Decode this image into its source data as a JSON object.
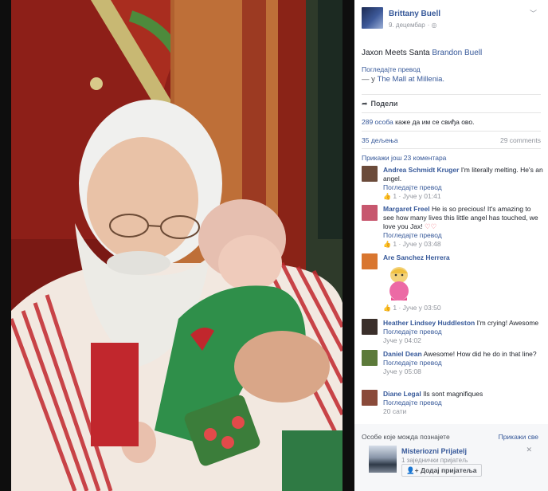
{
  "post": {
    "author": "Brittany Buell",
    "date": "9. децембар",
    "globe_icon": "globe-icon",
    "text_prefix": "Jaxon Meets Santa",
    "tagged": "Brandon Buell",
    "translate": "Погледајте превод",
    "location_prefix": "— у",
    "location": "The Mall at Millenia."
  },
  "actions": {
    "share": "Подели"
  },
  "stats": {
    "likes_count": "289 особа",
    "likes_suffix": "каже да им се свиђа ово.",
    "shares": "35 дељења",
    "comments": "29 comments",
    "more_comments": "Прикажи још 23 коментара"
  },
  "comments": [
    {
      "name": "Andrea Schmidt Kruger",
      "text": "I'm literally melting. He's an angel.",
      "translate": "Погледајте превод",
      "likes": "1",
      "time": "Јуче у 01:41",
      "avatar_color": "#6b4b3a"
    },
    {
      "name": "Margaret Freel",
      "text": "He is so precious! It's amazing to see how many lives this little angel has touched, we love you Jax!",
      "translate": "Погледајте превод",
      "likes": "1",
      "time": "Јуче у 03:48",
      "avatar_color": "#c7576e"
    },
    {
      "name": "Are Sanchez Herrera",
      "text": "",
      "likes": "1",
      "time": "Јуче у 03:50",
      "avatar_color": "#d9762f"
    },
    {
      "name": "Heather Lindsey Huddleston",
      "text": "I'm crying! Awesome",
      "translate": "Погледајте превод",
      "time": "Јуче у 04:02",
      "avatar_color": "#3a2f2a"
    },
    {
      "name": "Daniel Dean",
      "text": "Awesome! How did he do in that line?",
      "translate": "Погледајте превод",
      "time": "Јуче у 05:08",
      "avatar_color": "#5c7a3a"
    },
    {
      "name": "Diane Legal",
      "text": "Ils sont magnifiques",
      "translate": "Погледајте превод",
      "time": "20 сати",
      "avatar_color": "#8a4a3a"
    }
  ],
  "pymk": {
    "title": "Особе које можда познајете",
    "see_all": "Прикажи све",
    "name": "Misteriozni Prijatelj",
    "mutual": "1 заједнички пријатељ",
    "add_button": "Додај пријатеља"
  },
  "colors": {
    "link": "#365899",
    "meta": "#90949c",
    "heart": "#f05a6b"
  }
}
